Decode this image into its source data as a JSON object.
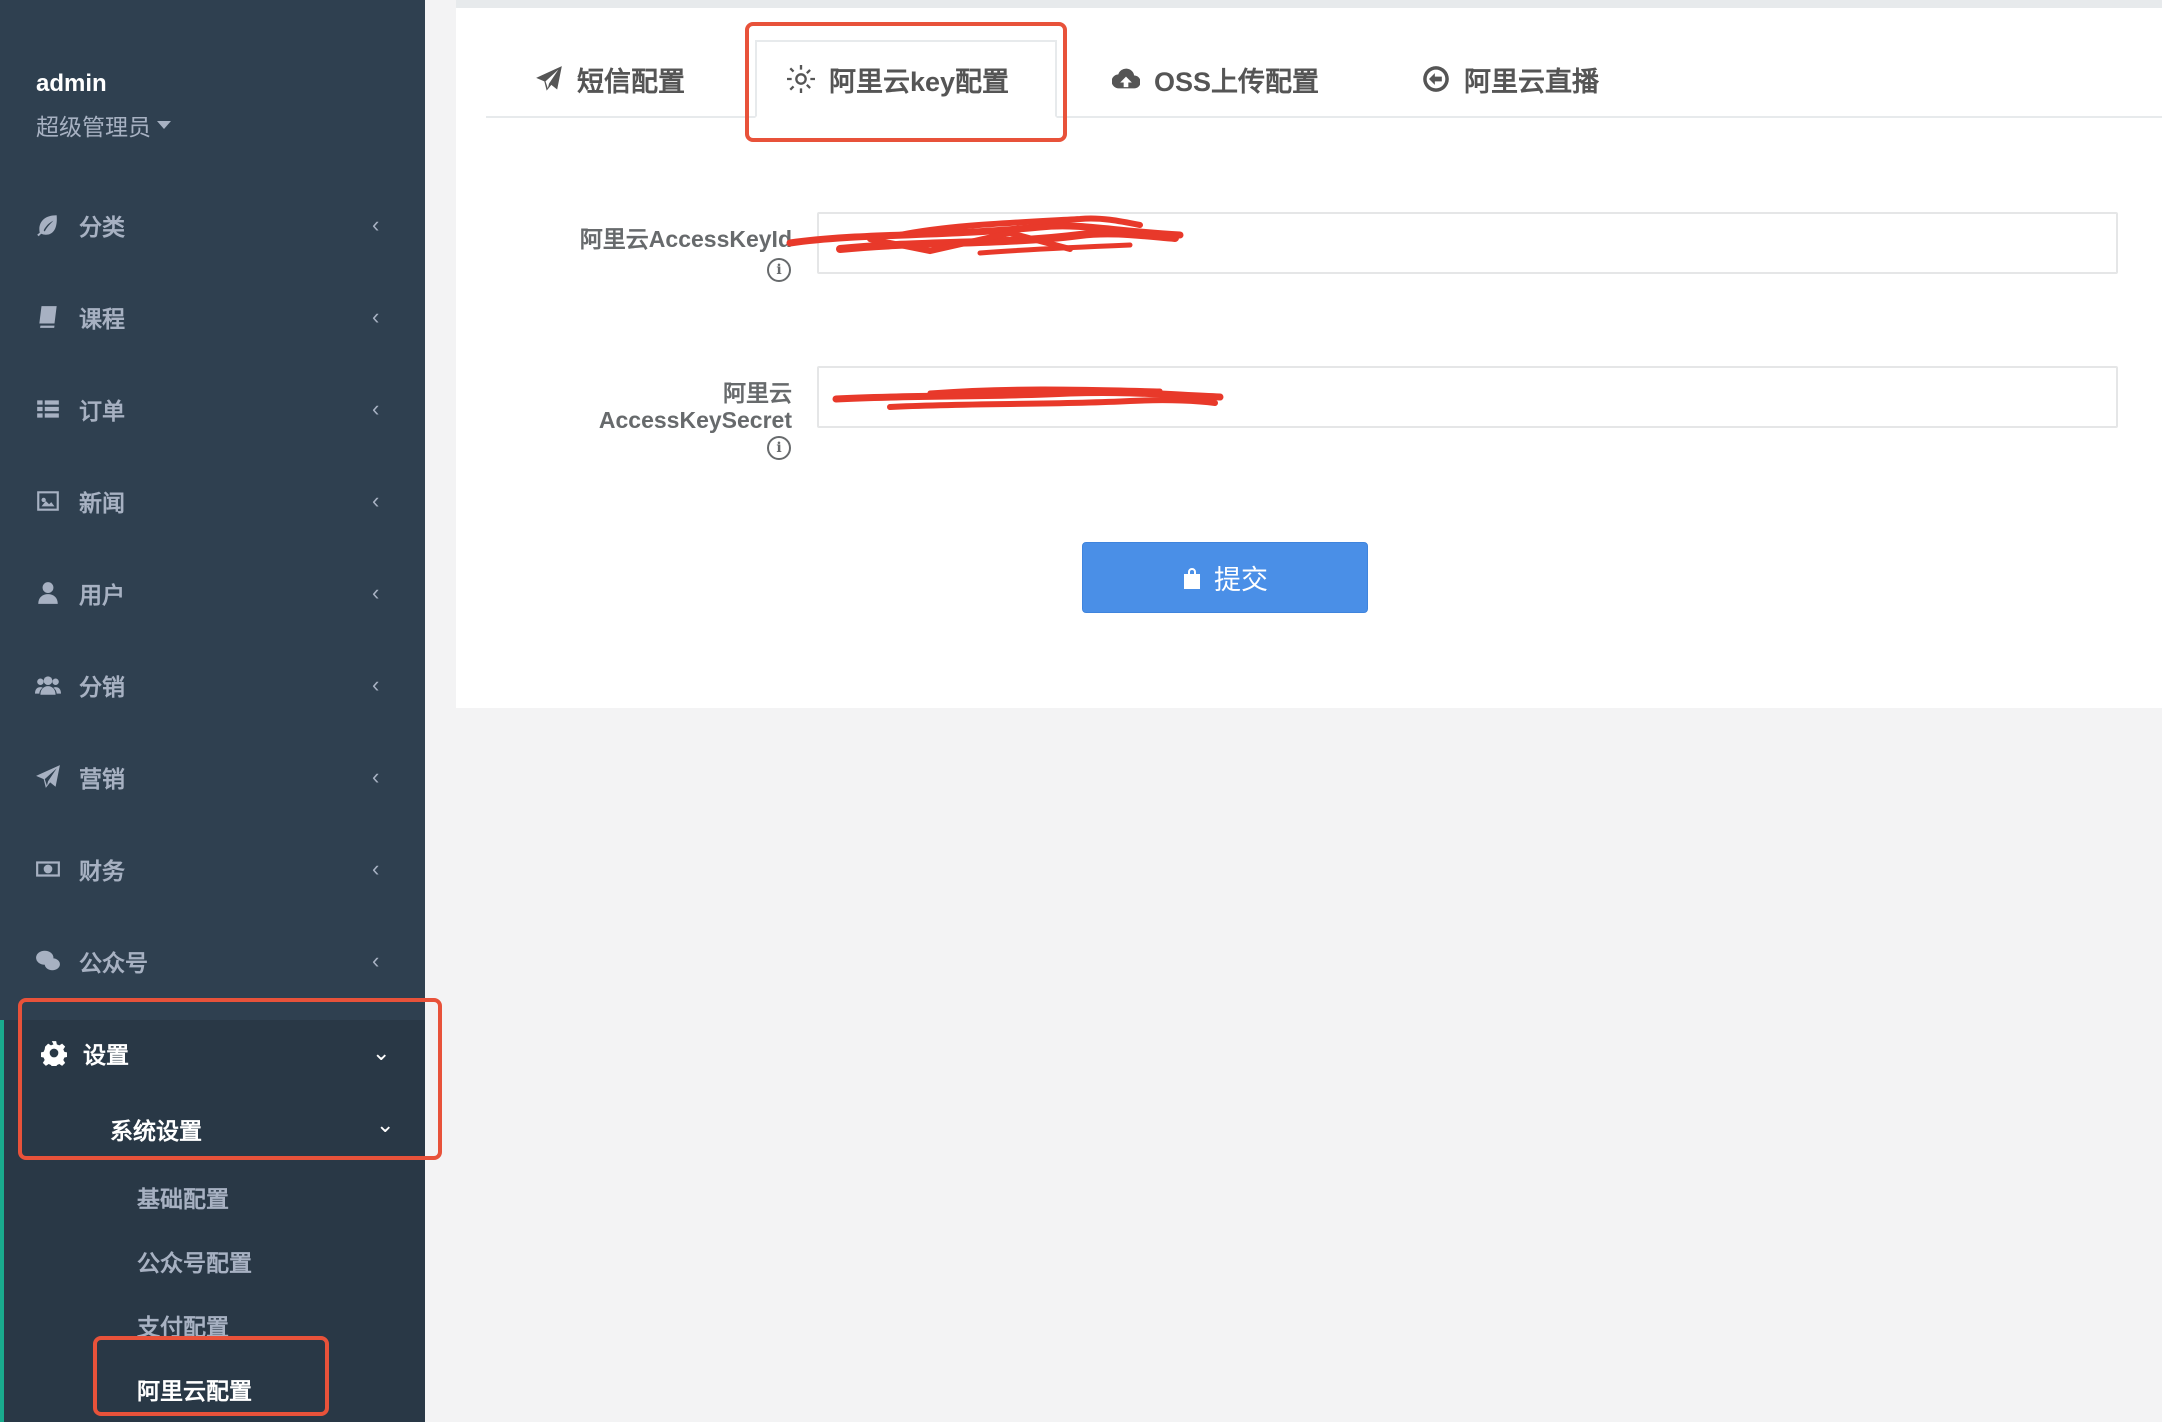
{
  "profile": {
    "name": "admin",
    "role": "超级管理员"
  },
  "sidebar": {
    "items": [
      {
        "label": "分类",
        "icon": "leaf-icon"
      },
      {
        "label": "课程",
        "icon": "book-icon"
      },
      {
        "label": "订单",
        "icon": "list-icon"
      },
      {
        "label": "新闻",
        "icon": "picture-icon"
      },
      {
        "label": "用户",
        "icon": "user-icon"
      },
      {
        "label": "分销",
        "icon": "users-icon"
      },
      {
        "label": "营销",
        "icon": "paper-plane-icon"
      },
      {
        "label": "财务",
        "icon": "money-icon"
      },
      {
        "label": "公众号",
        "icon": "wechat-icon"
      },
      {
        "label": "设置",
        "icon": "gear-icon"
      }
    ],
    "submenu": {
      "parent": "系统设置",
      "items": [
        "基础配置",
        "公众号配置",
        "支付配置",
        "阿里云配置"
      ]
    }
  },
  "tabs": [
    {
      "label": "短信配置",
      "icon": "paper-plane-icon"
    },
    {
      "label": "阿里云key配置",
      "icon": "sun-icon"
    },
    {
      "label": "OSS上传配置",
      "icon": "cloud-upload-icon"
    },
    {
      "label": "阿里云直播",
      "icon": "arrow-circle-left-icon"
    }
  ],
  "form": {
    "access_key_id_label": "阿里云AccessKeyId",
    "access_key_secret_label_line1": "阿里云",
    "access_key_secret_label_line2": "AccessKeySecret",
    "info_glyph": "i",
    "submit_label": "提交"
  },
  "colors": {
    "sidebar_bg": "#2f4050",
    "highlight": "#e8523a",
    "primary_button": "#4a8fe7"
  }
}
